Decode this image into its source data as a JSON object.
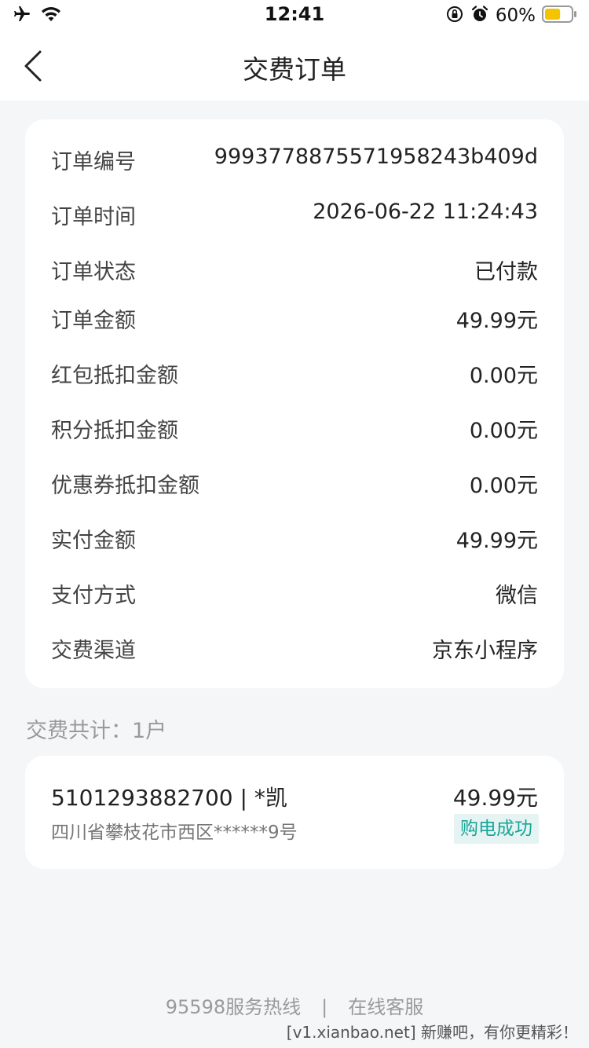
{
  "status_bar": {
    "time": "12:41",
    "battery_percent_text": "60%",
    "battery_level": 0.6,
    "icons": [
      "airplane-icon",
      "wifi-icon",
      "orientation-lock-icon",
      "alarm-icon",
      "battery-icon"
    ]
  },
  "header": {
    "title": "交费订单",
    "back_icon": "chevron-left-icon"
  },
  "order_details": {
    "rows": [
      {
        "label": "订单编号",
        "value": "999377887557195 8243b409d"
      },
      {
        "label": "订单时间",
        "value": "2026-06-22 11:24:43"
      },
      {
        "label": "订单状态",
        "value": "已付款"
      },
      {
        "label": "订单金额",
        "value": "49.99元"
      },
      {
        "label": "红包抵扣金额",
        "value": "0.00元"
      },
      {
        "label": "积分抵扣金额",
        "value": "0.00元"
      },
      {
        "label": "优惠券抵扣金额",
        "value": "0.00元"
      },
      {
        "label": "实付金额",
        "value": "49.99元"
      },
      {
        "label": "支付方式",
        "value": "微信"
      },
      {
        "label": "交费渠道",
        "value": "京东小程序"
      }
    ]
  },
  "summary": "交费共计：1户",
  "account": {
    "id_name": "5101293882700 | *凯",
    "address": "四川省攀枝花市西区******9号",
    "amount": "49.99元",
    "status": "购电成功"
  },
  "footer": {
    "hotline": "95598服务热线",
    "separator": "|",
    "online_service": "在线客服"
  },
  "watermark": "[v1.xianbao.net] 新赚吧，有你更精彩！",
  "colors": {
    "background": "#f5f6f8",
    "card": "#ffffff",
    "success_text": "#19a599",
    "success_bg": "#e5f4f3",
    "muted": "#9a9a9a"
  }
}
